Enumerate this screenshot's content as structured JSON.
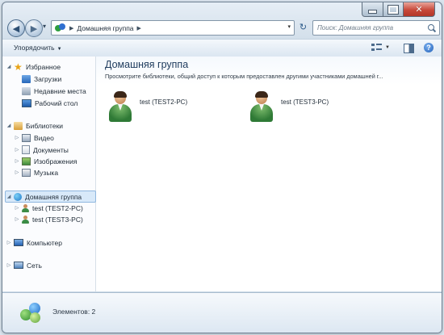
{
  "window": {
    "caption": {
      "minimize": "",
      "maximize": "",
      "close": "✕"
    }
  },
  "navbar": {
    "back_icon": "◀",
    "forward_icon": "▶",
    "history_dropdown": "▾",
    "address": {
      "separator_icon": "▶",
      "path": "Домашняя группа",
      "trail_icon": "▶",
      "dropdown": "▾"
    },
    "refresh_icon": "↻",
    "search": {
      "placeholder": "Поиск: Домашняя группа"
    }
  },
  "toolbar": {
    "organize_label": "Упорядочить",
    "organize_arrow": "▼",
    "views_arrow": "▼",
    "help_label": "?"
  },
  "navpane": {
    "favorites": {
      "label": "Избранное",
      "expander": "◢",
      "items": [
        {
          "label": "Загрузки"
        },
        {
          "label": "Недавние места"
        },
        {
          "label": "Рабочий стол"
        }
      ]
    },
    "libraries": {
      "label": "Библиотеки",
      "expander": "◢",
      "items": [
        {
          "label": "Видео",
          "expander": "▷"
        },
        {
          "label": "Документы",
          "expander": "▷"
        },
        {
          "label": "Изображения",
          "expander": "▷"
        },
        {
          "label": "Музыка",
          "expander": "▷"
        }
      ]
    },
    "homegroup": {
      "label": "Домашняя группа",
      "expander": "◢",
      "items": [
        {
          "label": "test (TEST2-PC)",
          "expander": "▷"
        },
        {
          "label": "test (TEST3-PC)",
          "expander": "▷"
        }
      ]
    },
    "computer": {
      "label": "Компьютер",
      "expander": "▷"
    },
    "network": {
      "label": "Сеть",
      "expander": "▷"
    }
  },
  "content": {
    "title": "Домашняя группа",
    "subtitle": "Просмотрите библиотеки, общий доступ к которым предоставлен другими участниками домашней г...",
    "members": [
      {
        "label": "test (TEST2-PC)"
      },
      {
        "label": "test (TEST3-PC)"
      }
    ]
  },
  "details": {
    "status": "Элементов: 2"
  }
}
